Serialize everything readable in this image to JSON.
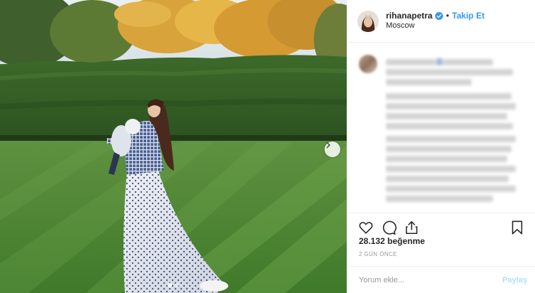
{
  "post": {
    "username": "rihanapetra",
    "separator": "•",
    "follow_label": "Takip Et",
    "location": "Moscow",
    "likes_text": "28.132 beğenme",
    "date_text": "2 GÜN ÖNCE",
    "comment_placeholder": "Yorum ekle...",
    "post_button_label": "Paylaş",
    "carousel": {
      "total_slides": 2,
      "active_slide": 1
    }
  },
  "icons": {
    "verified": "verified-badge-icon",
    "next": "chevron-right-icon",
    "like": "heart-icon",
    "comment": "comment-bubble-icon",
    "share": "share-icon",
    "save": "bookmark-icon"
  },
  "colors": {
    "accent": "#3897f0",
    "post_button_disabled": "#b2dffc",
    "muted_text": "#999999",
    "border": "#efefef"
  }
}
